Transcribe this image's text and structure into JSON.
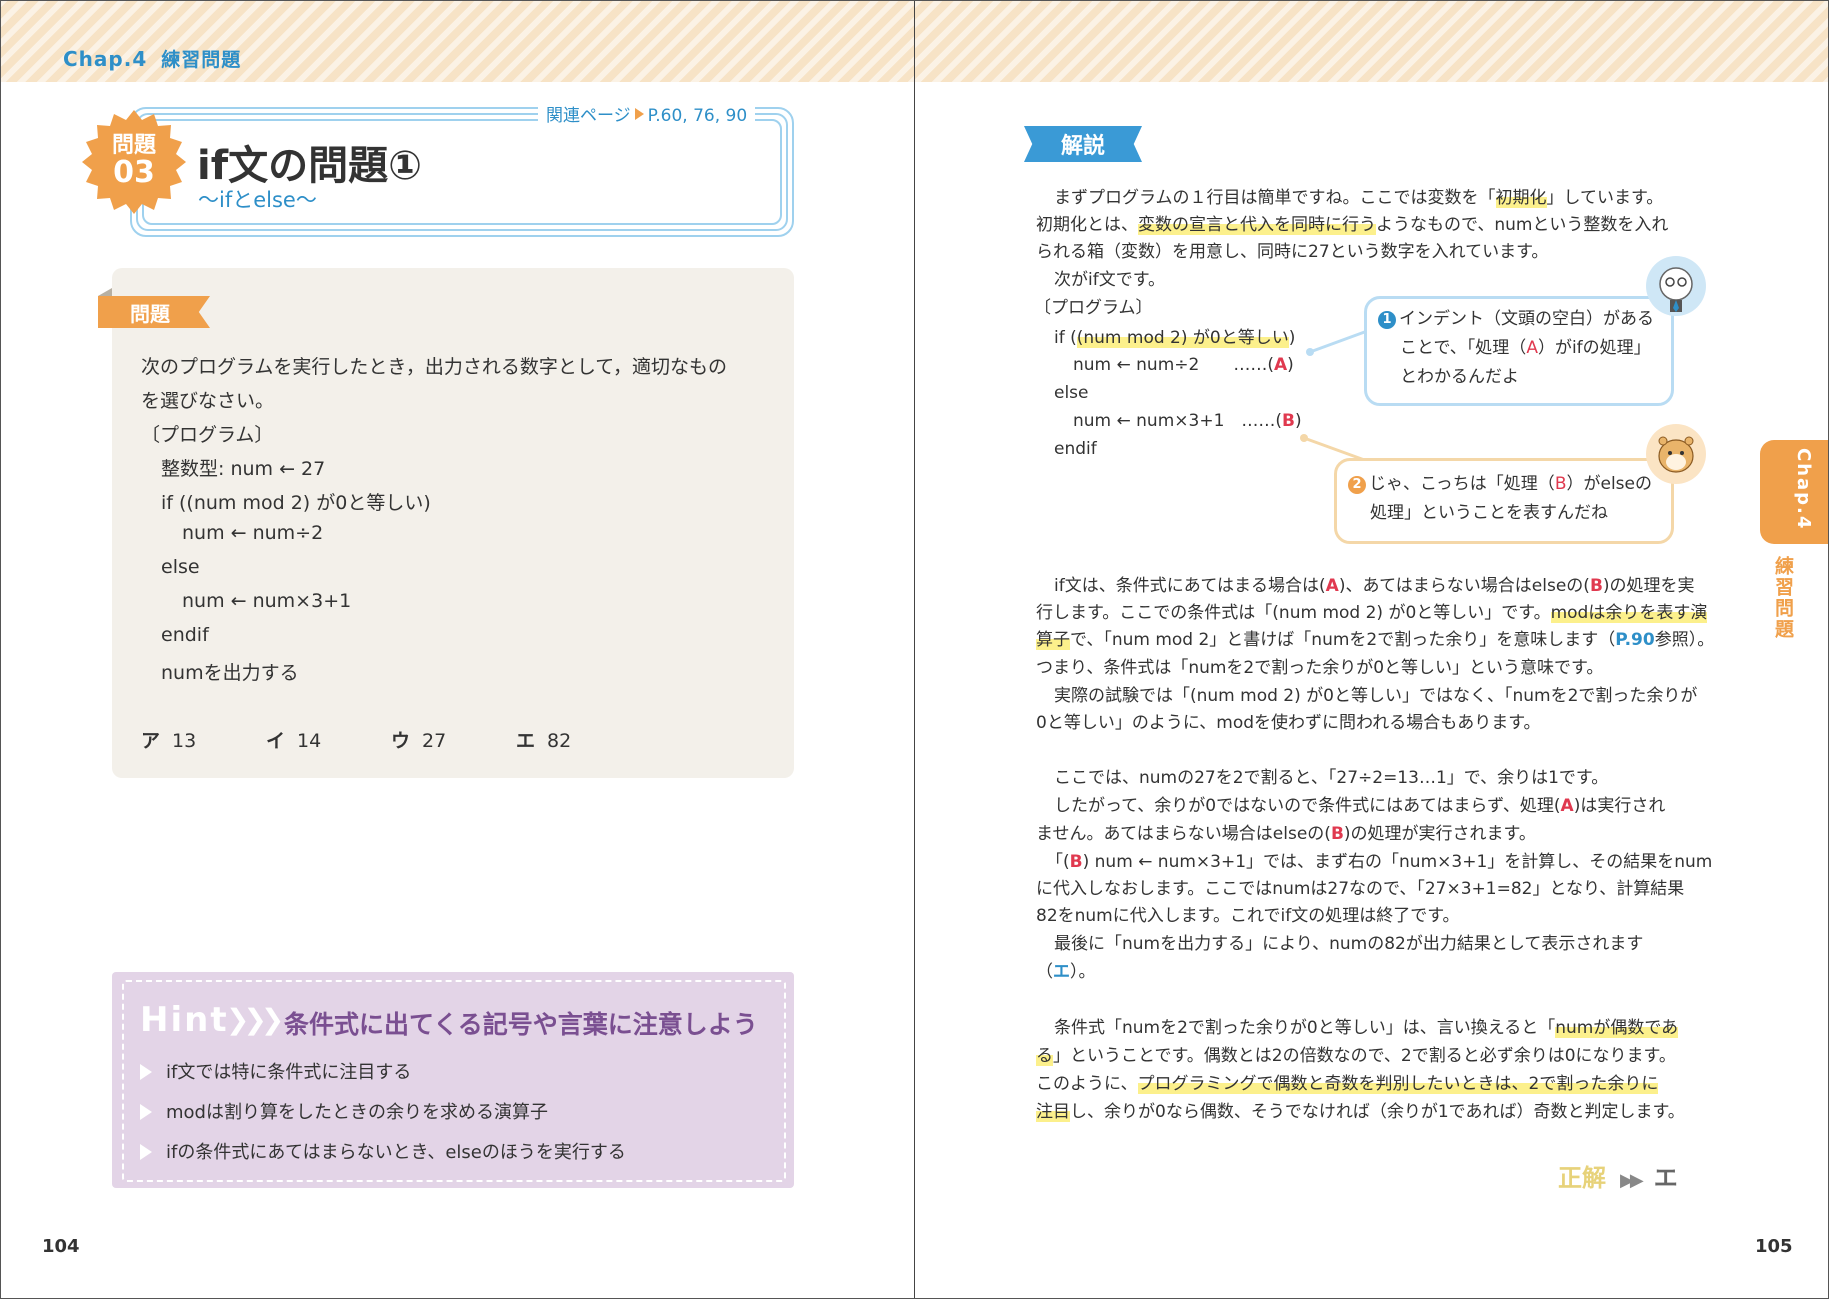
{
  "left_page": {
    "chapter": {
      "label": "Chap.4",
      "title": "練習問題"
    },
    "related": {
      "label": "関連ページ",
      "pages": "P.60, 76, 90"
    },
    "badge": {
      "line1": "問題",
      "line2": "03"
    },
    "title": "if文の問題①",
    "subtitle": "〜ifとelse〜",
    "problem": {
      "ribbon": "問題",
      "lines": [
        "次のプログラムを実行したとき，出力される数字として，適切なもの",
        "を選びなさい。",
        "〔プログラム〕",
        "整数型: num ← 27",
        "if ((num mod 2) が0と等しい)",
        "num ← num÷2",
        "else",
        "num ← num×3+1",
        "endif",
        "numを出力する"
      ],
      "choices": [
        {
          "key": "ア",
          "value": "13"
        },
        {
          "key": "イ",
          "value": "14"
        },
        {
          "key": "ウ",
          "value": "27"
        },
        {
          "key": "エ",
          "value": "82"
        }
      ]
    },
    "hint": {
      "title": "Hint",
      "arrows": "❯❯❯",
      "heading": "条件式に出てくる記号や言葉に注意しよう",
      "items": [
        "if文では特に条件式に注目する",
        "modは割り算をしたときの余りを求める演算子",
        "ifの条件式にあてはまらないとき、elseのほうを実行する"
      ]
    },
    "page_number": "104"
  },
  "right_page": {
    "section": "解説",
    "intro": {
      "l1a": "まずプログラムの１行目は簡単ですね。ここでは変数を「",
      "l1b": "初期化",
      "l1c": "」しています。",
      "l2a": "初期化とは、",
      "l2b": "変数の宣言と代入を同時に行う",
      "l2c": "ようなもので、numという整数を入れ",
      "l3": "られる箱（変数）を用意し、同時に27という数字を入れています。",
      "l4": "次がif文です。"
    },
    "program": {
      "label": "〔プログラム〕",
      "if_a": "if (",
      "if_b": "(num mod 2) が0と等しい",
      "if_c": ")",
      "a_line": "num ← num÷2　　……(",
      "a_mark": "A",
      "close": ")",
      "else": "else",
      "b_line": "num ← num×3+1　……(",
      "b_mark": "B",
      "endif": "endif"
    },
    "bubble1": {
      "num": "1",
      "l1": "インデント（文頭の空白）がある",
      "l2a": "ことで、「処理（",
      "l2b": "A",
      "l2c": "）がifの処理」",
      "l3": "とわかるんだよ"
    },
    "bubble2": {
      "num": "2",
      "l1a": "じゃ、こっちは「処理（",
      "l1b": "B",
      "l1c": "）がelseの",
      "l2": "処理」ということを表すんだね"
    },
    "body": {
      "p1a": "if文は、条件式にあてはまる場合は(",
      "p1b": "A",
      "p1c": ")、あてはまらない場合はelseの(",
      "p1d": "B",
      "p1e": ")の処理を実",
      "p2a": "行します。ここでの条件式は「(num mod 2) が0と等しい」です。",
      "p2b": "modは余りを表す演",
      "p3a": "算子",
      "p3b": "で、「num mod 2」と書けば「numを2で割った余り」を意味します（",
      "p3c": "P.90",
      "p3d": "参照）。",
      "p4": "つまり、条件式は「numを2で割った余りが0と等しい」という意味です。",
      "p5": "実際の試験では「(num mod 2) が0と等しい」ではなく、「numを2で割った余りが",
      "p6": "0と等しい」のように、modを使わずに問われる場合もあります。",
      "p7": "ここでは、numの27を2で割ると、「27÷2=13…1」で、余りは1です。",
      "p8a": "したがって、余りが0ではないので条件式にはあてはまらず、処理(",
      "p8b": "A",
      "p8c": ")は実行され",
      "p9a": "ません。あてはまらない場合はelseの(",
      "p9b": "B",
      "p9c": ")の処理が実行されます。",
      "p10a": "「(",
      "p10b": "B",
      "p10c": ") num ← num×3+1」では、まず右の「num×3+1」を計算し、その結果をnum",
      "p11": "に代入しなおします。ここではnumは27なので、「27×3+1=82」となり、計算結果",
      "p12": "82をnumに代入します。これでif文の処理は終了です。",
      "p13": "最後に「numを出力する」により、numの82が出力結果として表示されます",
      "p14a": "（",
      "p14b": "エ",
      "p14c": "）。",
      "p15a": "条件式「numを2で割った余りが0と等しい」は、言い換えると「",
      "p15b": "numが偶数であ",
      "p16a": "る",
      "p16b": "」ということです。偶数とは2の倍数なので、2で割ると必ず余りは0になります。",
      "p17a": "このように、",
      "p17b": "プログラミングで偶数と奇数を判別したいときは、2で割った余りに",
      "p18a": "注目",
      "p18b": "し、余りが0なら偶数、そうでなければ（余りが1であれば）奇数と判定します。"
    },
    "answer": {
      "label": "正解",
      "arrows": "▶▶",
      "value": "エ"
    },
    "side_tab": {
      "chapter": "Chap.4",
      "label": "練習問題"
    },
    "page_number": "105"
  },
  "colors": {
    "accent_orange": "#f0a04b",
    "accent_blue": "#2e8fc8",
    "hint_purple": "#7a4f91",
    "highlight": "#fcf08c",
    "mark_red": "#e0394f"
  }
}
